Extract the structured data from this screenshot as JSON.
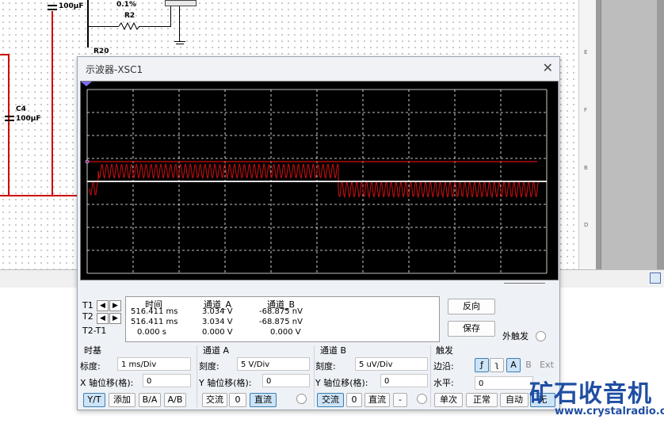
{
  "schematic": {
    "labels": [
      "100μF",
      "0.1%",
      "R2",
      "R20",
      "C4",
      "100μF"
    ]
  },
  "window": {
    "title": "示波器-XSC1",
    "close_label": "✕"
  },
  "readout": {
    "headers": [
      "时间",
      "通道_A",
      "通道_B"
    ],
    "rows": [
      {
        "label": "T1",
        "time": "516.411 ms",
        "a": "3.034 V",
        "b": "-68.875 nV"
      },
      {
        "label": "T2",
        "time": "516.411 ms",
        "a": "3.034 V",
        "b": "-68.875 nV"
      },
      {
        "label": "T2-T1",
        "time": "0.000 s",
        "a": "0.000 V",
        "b": "0.000 V"
      }
    ],
    "reverse_btn": "反向",
    "save_btn": "保存",
    "ext_trigger": "外触发"
  },
  "timebase": {
    "title": "时基",
    "scale_label": "标度:",
    "scale_value": "1 ms/Div",
    "x_offset_label": "X 轴位移(格):",
    "x_offset_value": "0",
    "buttons": [
      "Y/T",
      "添加",
      "B/A",
      "A/B"
    ]
  },
  "channel_a": {
    "title": "通道 A",
    "scale_label": "刻度:",
    "scale_value": "5  V/Div",
    "y_offset_label": "Y 轴位移(格):",
    "y_offset_value": "0",
    "buttons": [
      "交流",
      "0",
      "直流"
    ]
  },
  "channel_b": {
    "title": "通道 B",
    "scale_label": "刻度:",
    "scale_value": "5 uV/Div",
    "y_offset_label": "Y 轴位移(格):",
    "y_offset_value": "0",
    "buttons": [
      "交流",
      "0",
      "直流",
      "-"
    ]
  },
  "trigger": {
    "title": "触发",
    "edge_label": "边沿:",
    "edge_buttons": [
      "ƒ",
      "ʅ",
      "A",
      "B",
      "Ext"
    ],
    "level_label": "水平:",
    "level_value": "0",
    "mode_buttons": [
      "单次",
      "正常",
      "自动",
      "无"
    ]
  },
  "watermark": {
    "brand": "矿石收音机",
    "url": "www.crystalradio.cn"
  },
  "colors": {
    "trace": "#d01010",
    "grid": "#ffffff",
    "scope_bg": "#000000"
  }
}
